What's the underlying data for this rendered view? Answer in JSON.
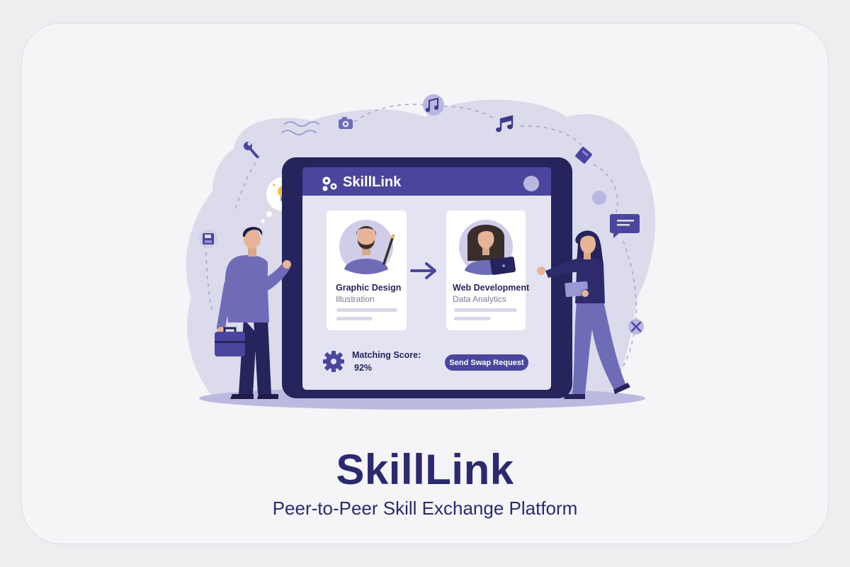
{
  "brand": {
    "title": "SkillLink",
    "subtitle": "Peer-to-Peer Skill Exchange Platform"
  },
  "app": {
    "title": "SkillLink",
    "left_card": {
      "primary_skill": "Graphic Design",
      "secondary_skill": "Illustration"
    },
    "right_card": {
      "primary_skill": "Web Development",
      "secondary_skill": "Data Analytics"
    },
    "matching_score_label": "Matching Score:",
    "matching_score_value": "92%",
    "swap_button_label": "Send Swap Request"
  },
  "icons": [
    "camera-icon",
    "music-note-icon",
    "music-note-icon",
    "wrench-icon",
    "book-icon",
    "lightbulb-icon",
    "floppy-disk-icon",
    "chat-bubble-icon",
    "scissors-icon",
    "gear-icon",
    "arrow-right-icon",
    "briefcase-icon",
    "laptop-icon"
  ],
  "colors": {
    "primary": "#4a469e",
    "dark": "#2b2a6e",
    "blob": "#dcdbec",
    "background": "#f5f5f7"
  }
}
